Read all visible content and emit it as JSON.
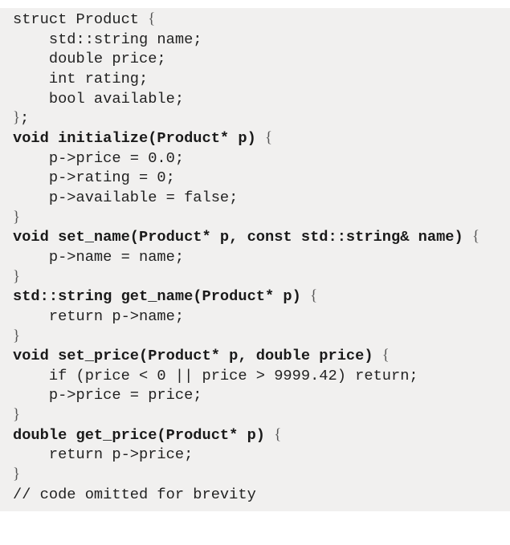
{
  "language": "C++",
  "lines": [
    [
      {
        "t": "struct Product "
      },
      {
        "t": "{",
        "brace": true
      }
    ],
    [
      {
        "t": "    std::string name;"
      }
    ],
    [
      {
        "t": "    double price;"
      }
    ],
    [
      {
        "t": "    int rating;"
      }
    ],
    [
      {
        "t": "    bool available;"
      }
    ],
    [
      {
        "t": "}",
        "brace": true
      },
      {
        "t": ";"
      }
    ],
    [
      {
        "t": "void initialize(Product* p) ",
        "b": true
      },
      {
        "t": "{",
        "brace": true
      }
    ],
    [
      {
        "t": "    p->price = 0.0;"
      }
    ],
    [
      {
        "t": "    p->rating = 0;"
      }
    ],
    [
      {
        "t": "    p->available = false;"
      }
    ],
    [
      {
        "t": "}",
        "brace": true
      }
    ],
    [
      {
        "t": "void set_name(Product* p, const std::string& name) ",
        "b": true
      },
      {
        "t": "{",
        "brace": true
      }
    ],
    [
      {
        "t": "    p->name = name;"
      }
    ],
    [
      {
        "t": "}",
        "brace": true
      }
    ],
    [
      {
        "t": "std::string get_name(Product* p) ",
        "b": true
      },
      {
        "t": "{",
        "brace": true
      }
    ],
    [
      {
        "t": "    return p->name;"
      }
    ],
    [
      {
        "t": "}",
        "brace": true
      }
    ],
    [
      {
        "t": "void set_price(Product* p, double price) ",
        "b": true
      },
      {
        "t": "{",
        "brace": true
      }
    ],
    [
      {
        "t": "    if (price < 0 || price > 9999.42) return;"
      }
    ],
    [
      {
        "t": "    p->price = price;"
      }
    ],
    [
      {
        "t": "}",
        "brace": true
      }
    ],
    [
      {
        "t": "double get_price(Product* p) ",
        "b": true
      },
      {
        "t": "{",
        "brace": true
      }
    ],
    [
      {
        "t": "    return p->price;"
      }
    ],
    [
      {
        "t": "}",
        "brace": true
      }
    ],
    [
      {
        "t": "// code omitted for brevity"
      }
    ]
  ]
}
